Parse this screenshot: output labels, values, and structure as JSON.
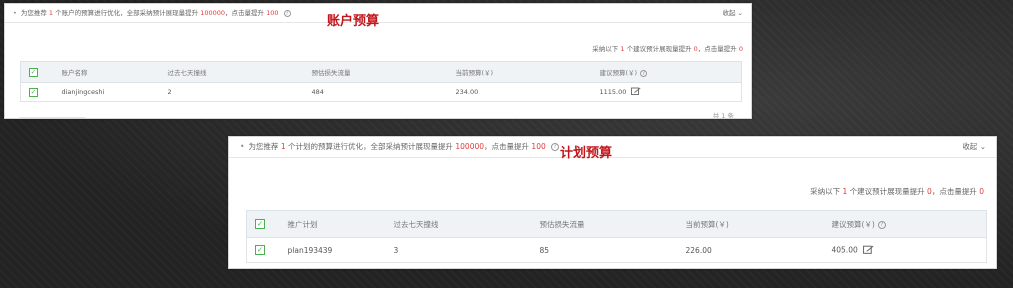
{
  "account_panel": {
    "recommend": {
      "prefix": "为您推荐",
      "count": "1",
      "middle": "个账户的预算进行优化，全部采纳预计展现量提升",
      "impressions": "100000",
      "comma_click": "，点击量提升",
      "clicks": "100"
    },
    "collapse_label": "收起",
    "section_title": "账户预算",
    "adopt": {
      "prefix": "采纳以下",
      "count": "1",
      "middle": "个建议预计展现量提升",
      "impressions": "0",
      "comma_click": "，点击量提升",
      "clicks": "0"
    },
    "columns": [
      "账户名称",
      "过去七天撞线",
      "预估损失流量",
      "当前预算(￥)",
      "建议预算(￥)"
    ],
    "rows": [
      {
        "name": "dianjingceshi",
        "days_hit": "2",
        "lost_traffic": "484",
        "current_budget": "234.00",
        "suggested_budget": "1115.00"
      }
    ],
    "pagination": "共 1 条"
  },
  "plan_panel": {
    "recommend": {
      "prefix": "为您推荐",
      "count": "1",
      "middle": "个计划的预算进行优化，全部采纳预计展现量提升",
      "impressions": "100000",
      "comma_click": "，点击量提升",
      "clicks": "100"
    },
    "collapse_label": "收起",
    "section_title": "计划预算",
    "adopt": {
      "prefix": "采纳以下",
      "count": "1",
      "middle": "个建议预计展现量提升",
      "impressions": "0",
      "comma_click": "，点击量提升",
      "clicks": "0"
    },
    "columns": [
      "推广计划",
      "过去七天撞线",
      "预估损失流量",
      "当前预算(￥)",
      "建议预算(￥)"
    ],
    "rows": [
      {
        "name": "plan193439",
        "days_hit": "3",
        "lost_traffic": "85",
        "current_budget": "226.00",
        "suggested_budget": "405.00"
      }
    ]
  },
  "icons": {
    "checkbox_glyph": "✓",
    "help_glyph": "?",
    "chevron_glyph": "⌄"
  },
  "colors": {
    "highlight_red": "#e03c3c",
    "title_red": "#c0161c",
    "checkbox_green": "#4caf50"
  }
}
